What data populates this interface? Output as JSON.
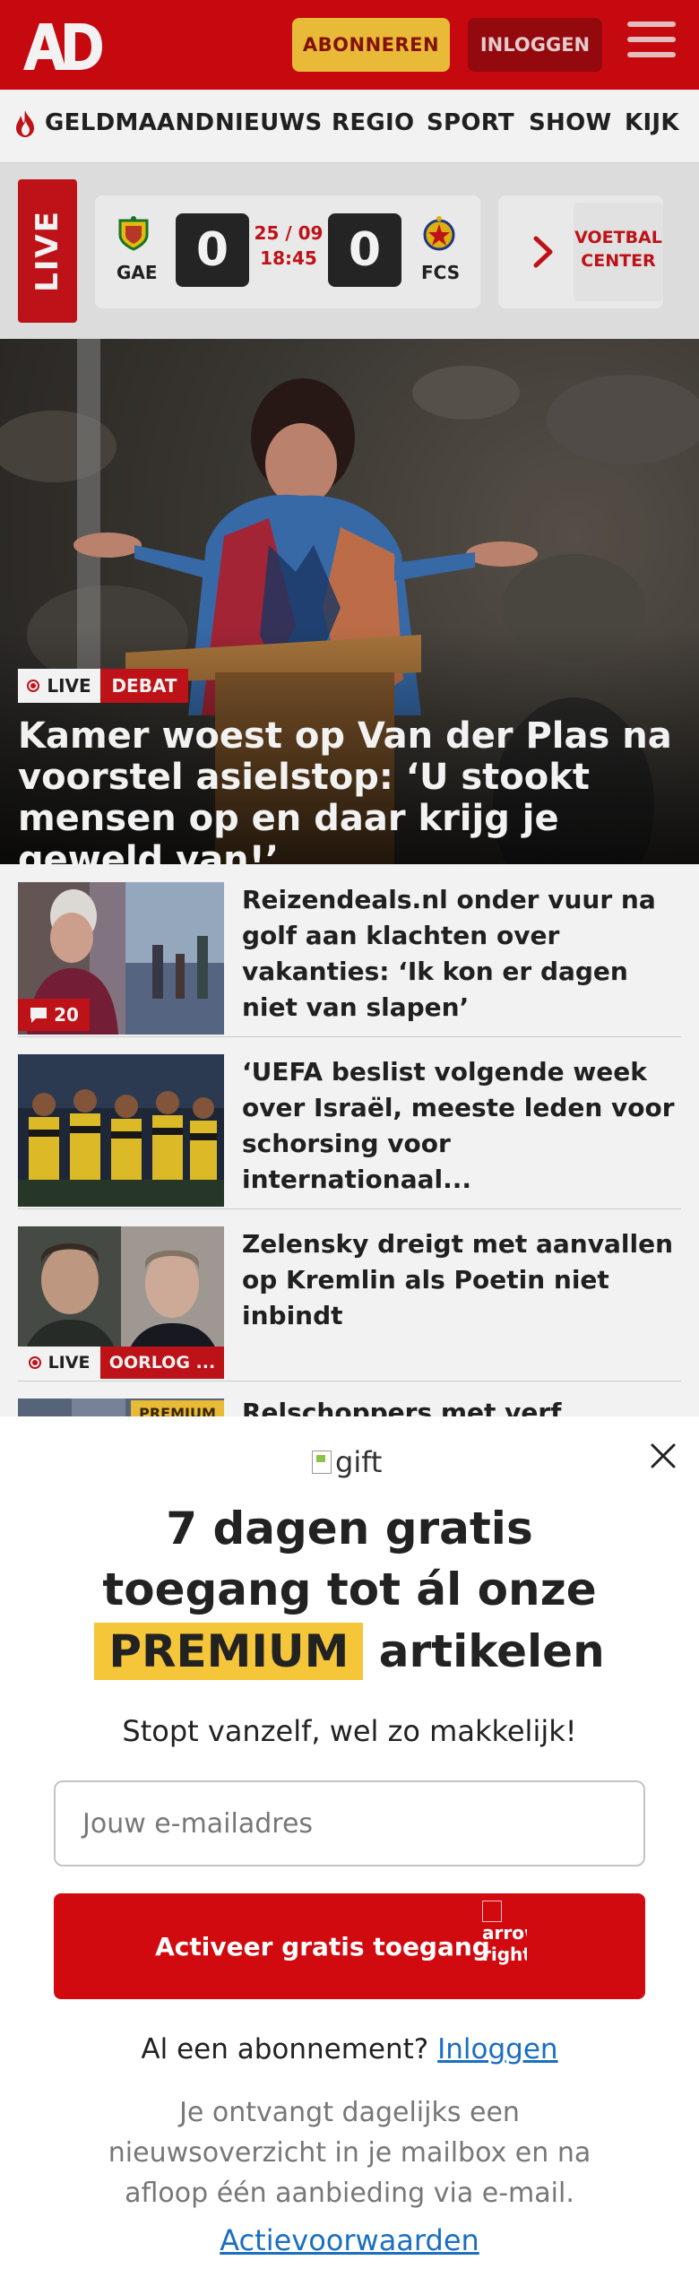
{
  "header": {
    "logo_text": "AD",
    "subscribe_label": "ABONNEREN",
    "login_label": "INLOGGEN",
    "menu_icon": "hamburger-icon",
    "colors": {
      "brand_red": "#d10a10",
      "subscribe_yellow": "#f5c53a"
    }
  },
  "nav": {
    "items": [
      "GELDMAAND",
      "NIEUWS",
      "REGIO",
      "SPORT",
      "SHOW",
      "KIJK"
    ]
  },
  "live": {
    "label": "LIVE",
    "match": {
      "home": "GAE",
      "away": "FCS",
      "home_score": "0",
      "away_score": "0",
      "date": "25 / 09",
      "time": "18:45"
    },
    "voetbal_center": [
      "VOETBAL",
      "CENTER"
    ]
  },
  "hero": {
    "badge_live": "LIVE",
    "badge_category": "DEBAT",
    "title": "Kamer woest op Van der Plas na voorstel asielstop: ‘U stookt mensen op en daar krijg je geweld van!’"
  },
  "articles": [
    {
      "title": "Reizendeals.nl onder vuur na golf aan klachten over vakanties: ‘Ik kon er dagen niet van slapen’",
      "comments": "20"
    },
    {
      "title": "‘UEFA beslist volgende week over Israël, meeste leden voor schorsing voor internationaal..."
    },
    {
      "title": "Zelensky dreigt met aanvallen op Kremlin als Poetin niet inbindt",
      "badge_live": "LIVE",
      "badge_category": "OORLOG ..."
    },
    {
      "title": "Relschoppers met verf smurfen",
      "badge_premium": "PREMIUM"
    }
  ],
  "modal": {
    "gift_alt": "gift",
    "heading_line1": "7 dagen gratis",
    "heading_line2": "toegang tot ál onze",
    "heading_highlight": "PREMIUM",
    "heading_line3_rest": "artikelen",
    "subtitle": "Stopt vanzelf, wel zo makkelijk!",
    "email_placeholder": "Jouw e-mailadres",
    "cta_label": "Activeer gratis toegang",
    "cta_arrow_alt": "arrow right",
    "have_subscription": "Al een abonnement?",
    "login_link": "Inloggen",
    "fine_print": "Je ontvangt dagelijks een nieuwsoverzicht in je mailbox en na afloop één aanbieding via e-mail.",
    "terms_link": "Actievoorwaarden"
  }
}
